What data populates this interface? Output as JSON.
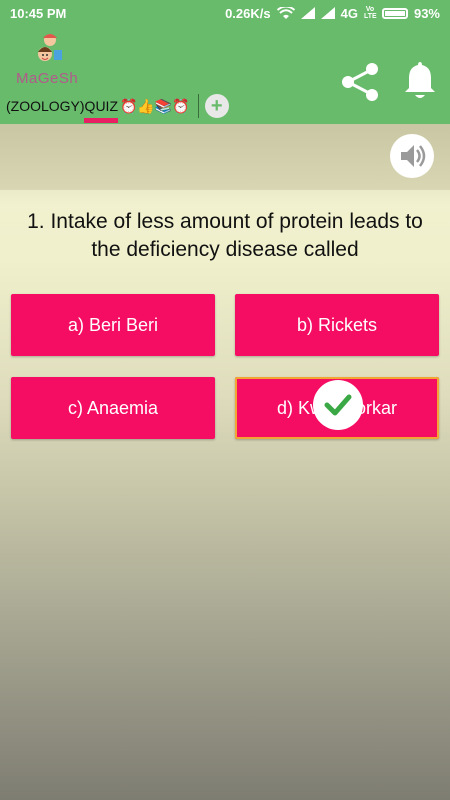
{
  "status_bar": {
    "time": "10:45 PM",
    "network_speed": "0.26K/s",
    "network_type": "4G",
    "volte": "Vo LTE",
    "battery": "93%"
  },
  "app_bar": {
    "logo_text": "MaGeSh",
    "tab_label": "(ZOOLOGY)QUIZ",
    "tab_emoji": "⏰👍📚⏰",
    "add_tab_label": "+"
  },
  "quiz": {
    "question": "1. Intake of less amount of protein leads to the deficiency disease called",
    "options": [
      {
        "label": "a) Beri Beri"
      },
      {
        "label": "b) Rickets"
      },
      {
        "label": "c) Anaemia"
      },
      {
        "label": "d) Kwashiorkar"
      }
    ],
    "correct_option": "d"
  },
  "colors": {
    "primary": "#67bb6a",
    "accent": "#f50d63",
    "indicator": "#e91e63",
    "check": "#3aa845"
  }
}
